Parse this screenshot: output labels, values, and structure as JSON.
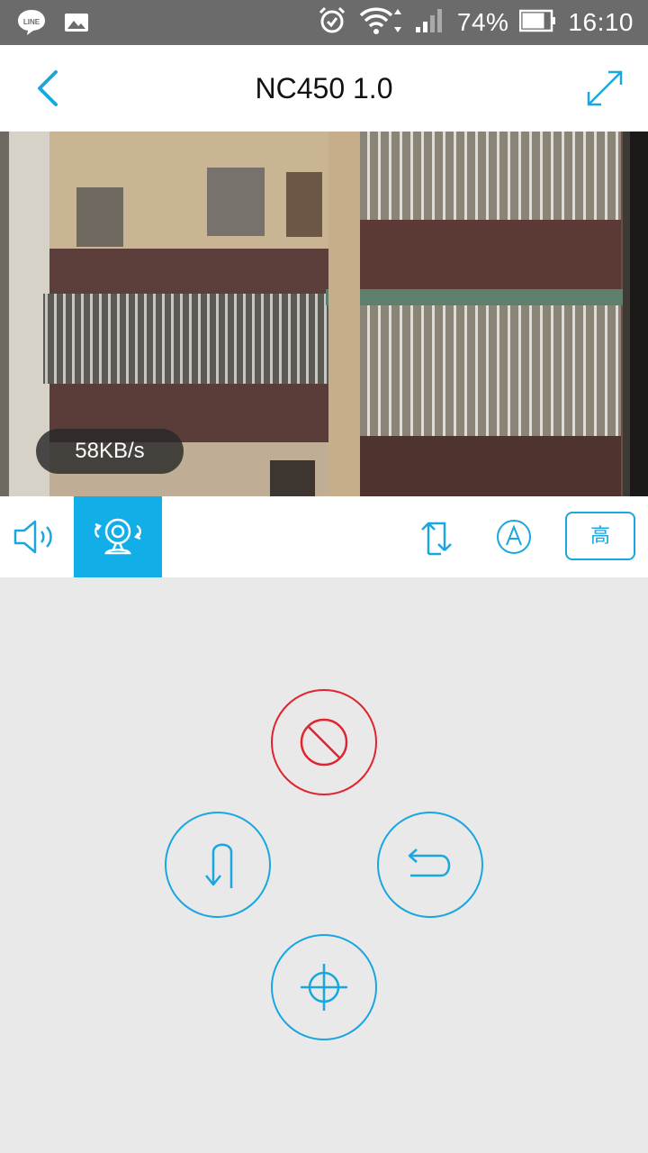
{
  "status_bar": {
    "battery_percent": "74%",
    "time": "16:10",
    "icons": [
      "line-icon",
      "gallery-icon",
      "alarm-icon",
      "wifi-icon",
      "signal-icon",
      "battery-icon"
    ]
  },
  "app_bar": {
    "title": "NC450 1.0",
    "back_icon": "chevron-left-icon",
    "fullscreen_icon": "expand-icon"
  },
  "video": {
    "bitrate": "58KB/s"
  },
  "toolbar": {
    "quality_label": "高",
    "icons": [
      "speaker-icon",
      "camera-pan-icon",
      "flip-icon",
      "auto-icon"
    ]
  },
  "controls": {
    "icons": [
      "stop-icon",
      "u-turn-icon",
      "return-icon",
      "crosshair-icon"
    ]
  },
  "colors": {
    "accent": "#1aa6df",
    "active_bg": "#12aee8",
    "stop_red": "#e0232e",
    "status_bar": "#6b6b6b",
    "panel_bg": "#e9e9e9"
  }
}
